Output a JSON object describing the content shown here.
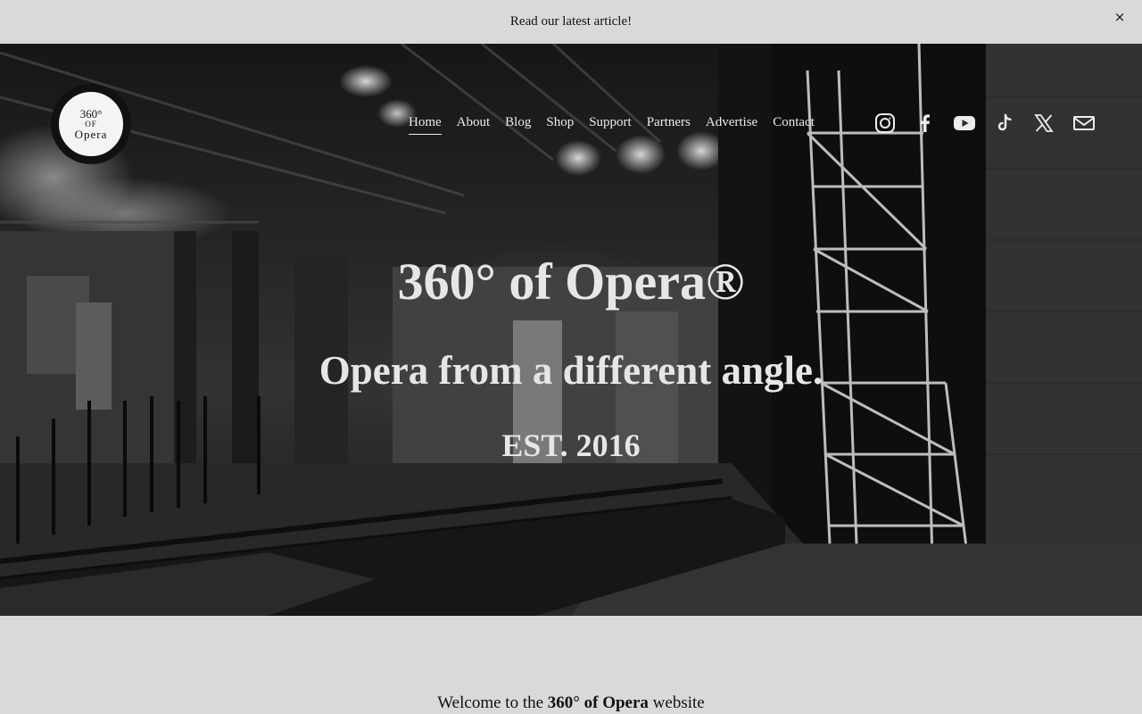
{
  "announcement": {
    "text": "Read our latest article!",
    "close_label": "×"
  },
  "logo": {
    "line1": "360°",
    "line2": "OF",
    "line3": "Opera"
  },
  "nav": {
    "items": [
      {
        "label": "Home",
        "active": true
      },
      {
        "label": "About",
        "active": false
      },
      {
        "label": "Blog",
        "active": false
      },
      {
        "label": "Shop",
        "active": false
      },
      {
        "label": "Support",
        "active": false
      },
      {
        "label": "Partners",
        "active": false
      },
      {
        "label": "Advertise",
        "active": false
      },
      {
        "label": "Contact",
        "active": false
      }
    ]
  },
  "social": {
    "icons": [
      "instagram-icon",
      "facebook-icon",
      "youtube-icon",
      "tiktok-icon",
      "x-icon",
      "email-icon"
    ]
  },
  "hero": {
    "title": "360° of Opera®",
    "subtitle": "Opera from a different angle.",
    "established": "EST. 2016"
  },
  "welcome": {
    "prefix": "Welcome to the ",
    "brand": "360° of Opera",
    "suffix": " website"
  },
  "colors": {
    "page_background": "#d9d9d9",
    "hero_text": "#e6e6e6",
    "body_text": "#111111"
  }
}
